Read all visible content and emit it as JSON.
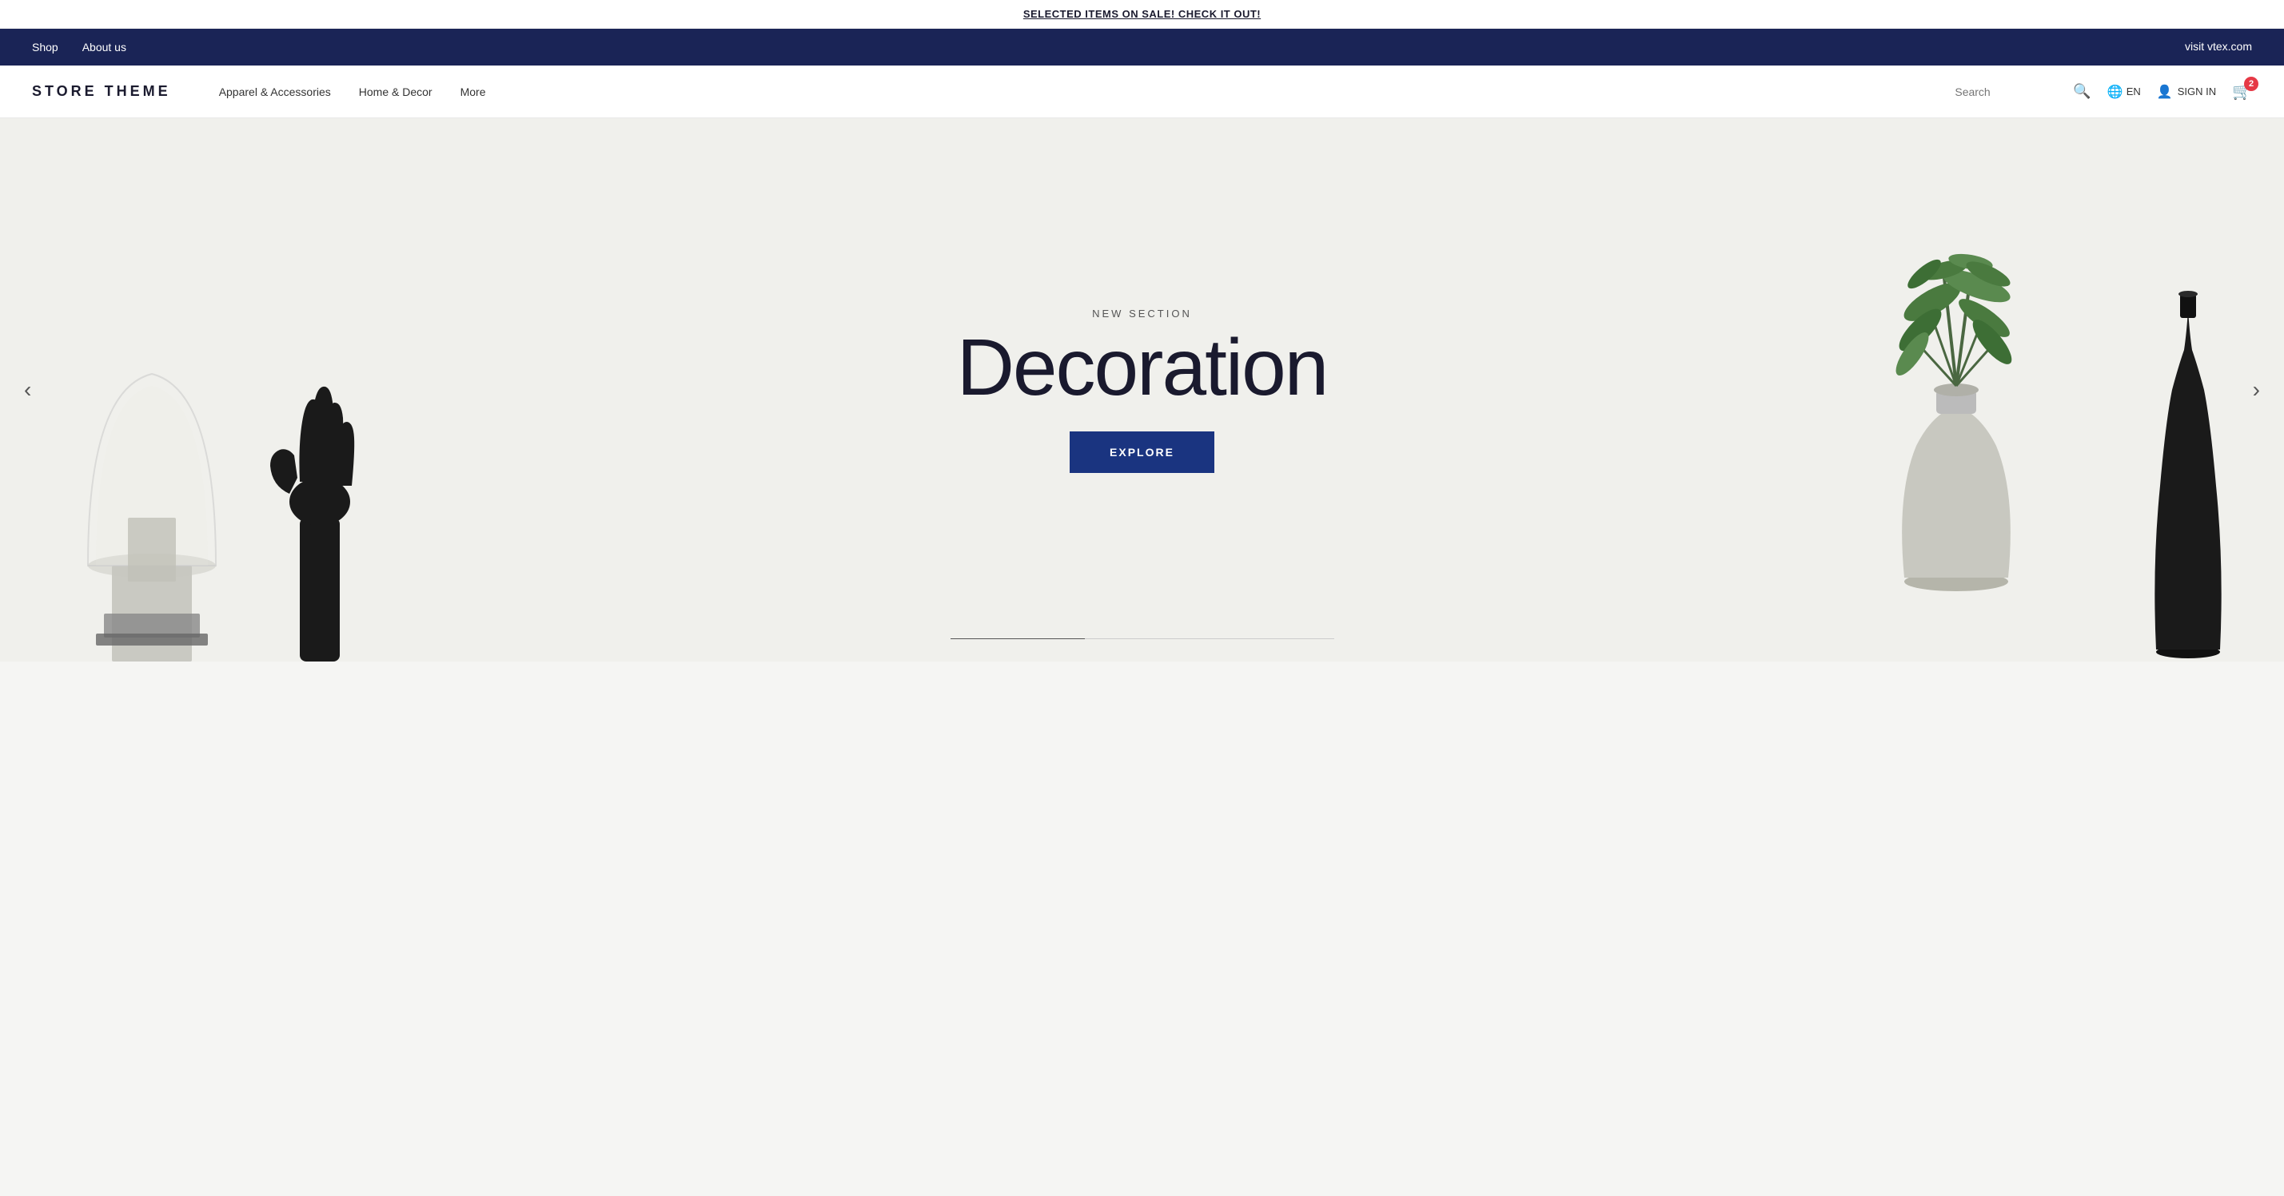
{
  "announcement": {
    "text": "SELECTED ITEMS ON SALE! CHECK IT OUT!",
    "link_text": "SELECTED ITEMS ON SALE! CHECK IT OUT!"
  },
  "top_nav": {
    "links": [
      {
        "label": "Shop",
        "url": "#"
      },
      {
        "label": "About us",
        "url": "#"
      }
    ],
    "right_link": "visit vtex.com"
  },
  "header": {
    "logo": "STORE THEME",
    "nav": [
      {
        "label": "Apparel & Accessories"
      },
      {
        "label": "Home & Decor"
      },
      {
        "label": "More"
      }
    ],
    "search_placeholder": "Search",
    "language": "EN",
    "sign_in": "SIGN IN",
    "cart_count": "2"
  },
  "hero": {
    "subtitle": "NEW SECTION",
    "title": "Decoration",
    "button_label": "EXPLORE"
  },
  "arrows": {
    "left": "‹",
    "right": "›"
  }
}
